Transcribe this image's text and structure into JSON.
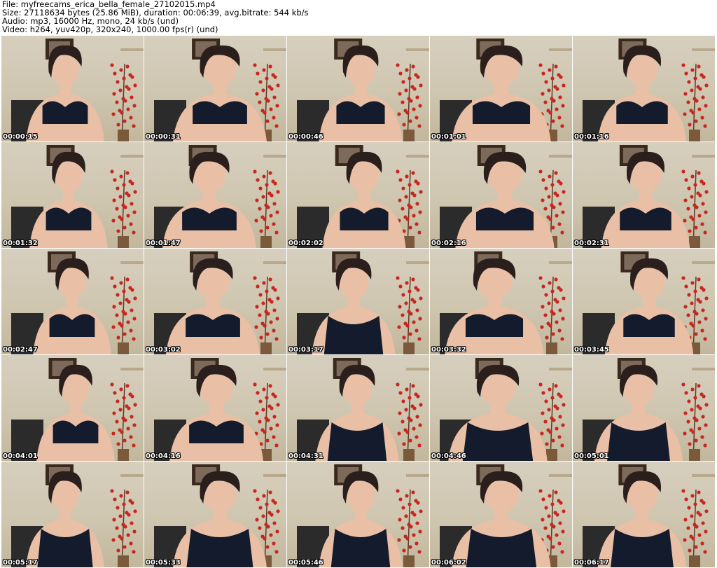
{
  "header": {
    "file": "File: myfreecams_erica_bella_female_27102015.mp4",
    "size": "Size: 27118634 bytes (25.86 MiB), duration: 00:06:39, avg.bitrate: 544 kb/s",
    "audio": "Audio: mp3, 16000 Hz, mono, 24 kb/s (und)",
    "video": "Video: h264, yuv420p, 320x240, 1000.00 fps(r) (und)"
  },
  "thumbnails": [
    {
      "timestamp": "00:00:15",
      "garment": "bra"
    },
    {
      "timestamp": "00:00:31",
      "garment": "bra"
    },
    {
      "timestamp": "00:00:46",
      "garment": "bra"
    },
    {
      "timestamp": "00:01:01",
      "garment": "bra"
    },
    {
      "timestamp": "00:01:16",
      "garment": "bra"
    },
    {
      "timestamp": "00:01:32",
      "garment": "bra"
    },
    {
      "timestamp": "00:01:47",
      "garment": "bra"
    },
    {
      "timestamp": "00:02:02",
      "garment": "bra"
    },
    {
      "timestamp": "00:02:16",
      "garment": "bra"
    },
    {
      "timestamp": "00:02:31",
      "garment": "bra"
    },
    {
      "timestamp": "00:02:47",
      "garment": "bra"
    },
    {
      "timestamp": "00:03:02",
      "garment": "bra"
    },
    {
      "timestamp": "00:03:17",
      "garment": "top"
    },
    {
      "timestamp": "00:03:32",
      "garment": "bra"
    },
    {
      "timestamp": "00:03:45",
      "garment": "bra"
    },
    {
      "timestamp": "00:04:01",
      "garment": "bra"
    },
    {
      "timestamp": "00:04:16",
      "garment": "bra"
    },
    {
      "timestamp": "00:04:31",
      "garment": "top"
    },
    {
      "timestamp": "00:04:46",
      "garment": "top"
    },
    {
      "timestamp": "00:05:01",
      "garment": "top"
    },
    {
      "timestamp": "00:05:17",
      "garment": "top"
    },
    {
      "timestamp": "00:05:33",
      "garment": "top"
    },
    {
      "timestamp": "00:05:46",
      "garment": "top"
    },
    {
      "timestamp": "00:06:02",
      "garment": "top"
    },
    {
      "timestamp": "00:06:17",
      "garment": "top"
    }
  ],
  "colors": {
    "wall": "#d6cdba",
    "skin": "#e9bfa6",
    "hair": "#2a1f1c",
    "garment": "#141b2c",
    "berries": "#c8261f",
    "chair": "#2b2b2b",
    "picture_frame": "#3a2a1e",
    "timestamp_text": "#ffffff"
  }
}
